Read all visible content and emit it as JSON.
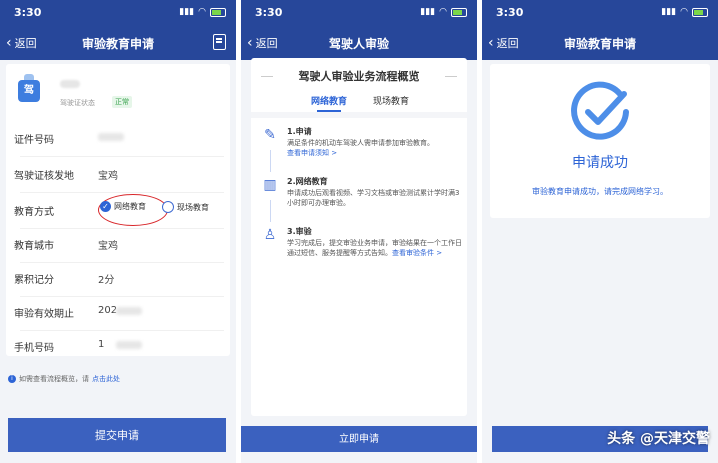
{
  "status_bar": {
    "time": "3:30"
  },
  "panels": {
    "p1": {
      "back_label": "返回",
      "title": "审验教育申请",
      "license_status_label": "驾驶证状态",
      "license_status_value": "正常",
      "fields": [
        {
          "label": "证件号码",
          "value": ""
        },
        {
          "label": "驾驶证核发地",
          "value": "宝鸡"
        },
        {
          "label": "教育方式",
          "value": ""
        },
        {
          "label": "教育城市",
          "value": "宝鸡"
        },
        {
          "label": "累积记分",
          "value": "2分"
        },
        {
          "label": "审验有效期止",
          "value": "202"
        },
        {
          "label": "手机号码",
          "value": "1"
        }
      ],
      "options": {
        "online": "网络教育",
        "onsite": "现场教育"
      },
      "hint_text": "如需查看流程概览，请",
      "hint_link": "点击此处",
      "submit_label": "提交申请"
    },
    "p2": {
      "back_label": "返回",
      "title": "驾驶人审验",
      "card_title": "驾驶人审验业务流程概览",
      "tabs": [
        "网络教育",
        "现场教育"
      ],
      "steps": [
        {
          "title": "1.申请",
          "desc": "满足条件的机动车驾驶人需申请参加审验教育。",
          "link": "查看申请须知 >"
        },
        {
          "title": "2.网络教育",
          "desc": "申请成功后观看视频、学习文档或审验测试累计学时满3小时即可办理审验。",
          "link": ""
        },
        {
          "title": "3.审验",
          "desc": "学习完成后，提交审验业务申请，审验结果在一个工作日通过短信、服务提醒等方式告知。",
          "link": "查看审验条件 >"
        }
      ],
      "apply_label": "立即申请"
    },
    "p3": {
      "back_label": "返回",
      "title": "审验教育申请",
      "success_title": "申请成功",
      "success_msg": "审验教育申请成功，请完成网络学习。"
    }
  },
  "watermark": "头条 @天津交警",
  "colors": {
    "brand": "#27479a",
    "accent": "#2d64d6",
    "highlight": "#d8262a"
  }
}
